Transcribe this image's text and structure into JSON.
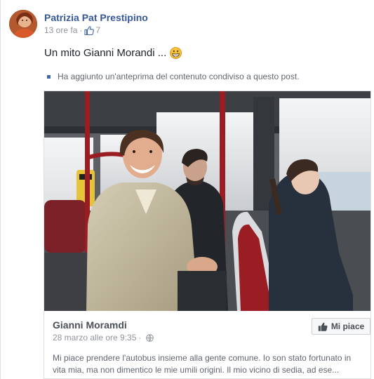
{
  "post": {
    "author": "Patrizia Pat Prestipino",
    "time": "13 ore fa",
    "separator": "·",
    "like_count": "7",
    "text": "Un mito Gianni Morandi ...",
    "emoji": "grinning-face",
    "attachment_note": "Ha aggiunto un'anteprima del contenuto condiviso a questo post."
  },
  "shared": {
    "page_name": "Gianni Moramdi",
    "date": "28 marzo alle ore 9:35",
    "separator": "·",
    "like_button_label": "Mi piace",
    "excerpt": "Mi piace prendere l'autobus insieme alla gente comune. Io son stato fortunato in vita mia, ma non dimentico le mie umili origini. Il mio vicino di sedia, ad ese..."
  },
  "colors": {
    "author_link": "#365899",
    "meta_gray": "#90949c",
    "accent_blue": "#4267b2",
    "bus_red": "#9b1d24"
  },
  "icons": [
    "avatar-photo",
    "like-thumb-icon",
    "grinning-emoji-icon",
    "bullet-icon",
    "globe-icon"
  ]
}
